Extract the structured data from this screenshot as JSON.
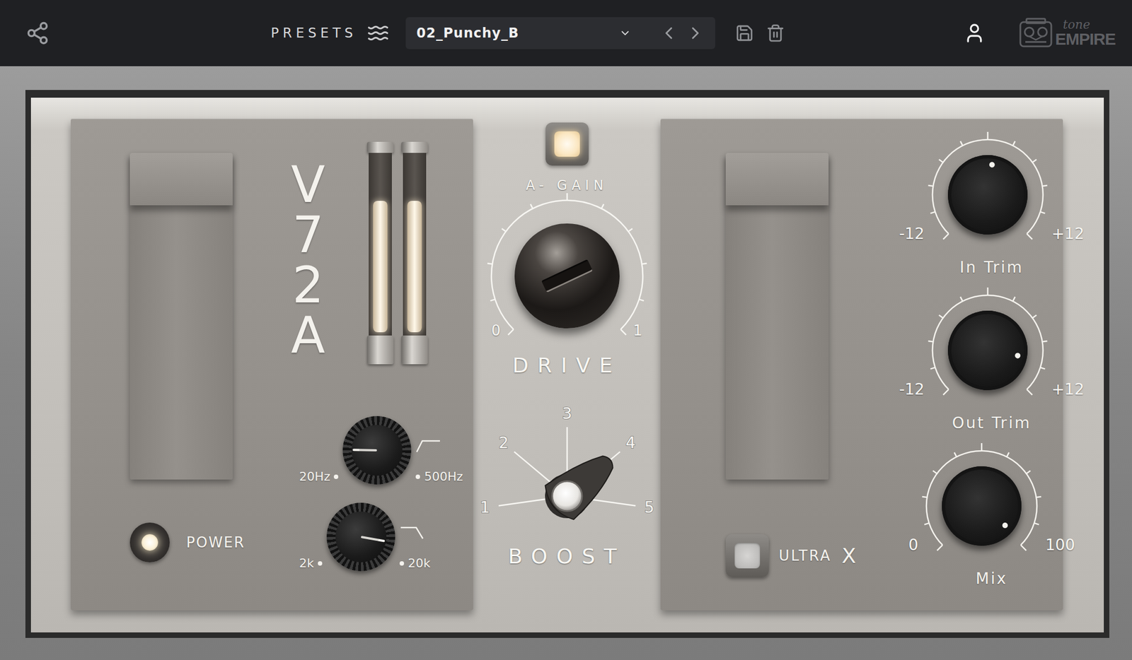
{
  "toolbar": {
    "presets_label": "PRESETS",
    "preset": "02_Punchy_B"
  },
  "brand": {
    "logo_script": "tone",
    "logo_name": "EMPIRE"
  },
  "left_panel": {
    "model": "V72A",
    "power": {
      "label": "POWER",
      "on": true
    },
    "meters": [
      {
        "level": 0.72
      },
      {
        "level": 0.72
      }
    ],
    "filters": [
      {
        "kind": "high-pass",
        "min": "20Hz",
        "max": "500Hz",
        "level": 0.17
      },
      {
        "kind": "low-pass",
        "min": "2k",
        "max": "20k",
        "level": 0.87
      }
    ]
  },
  "center": {
    "a_gain": {
      "label": "A- GAIN",
      "on": true
    },
    "drive": {
      "label": "DRIVE",
      "min": "0",
      "max": "1",
      "level": 0.74
    },
    "boost": {
      "label": "BOOST",
      "positions": [
        {
          "label": "1",
          "selected": false
        },
        {
          "label": "2",
          "selected": false
        },
        {
          "label": "3",
          "selected": false
        },
        {
          "label": "4",
          "selected": true
        },
        {
          "label": "5",
          "selected": false
        }
      ]
    }
  },
  "right_panel": {
    "ultra": {
      "label": "ULTRA",
      "mark": "X",
      "on": false
    },
    "knobs": [
      {
        "label": "In Trim",
        "min": "-12",
        "max": "+12",
        "level": 0.53
      },
      {
        "label": "Out Trim",
        "min": "-12",
        "max": "+12",
        "level": 0.87
      },
      {
        "label": "Mix",
        "min": "0",
        "max": "100",
        "level": 0.98
      }
    ]
  }
}
